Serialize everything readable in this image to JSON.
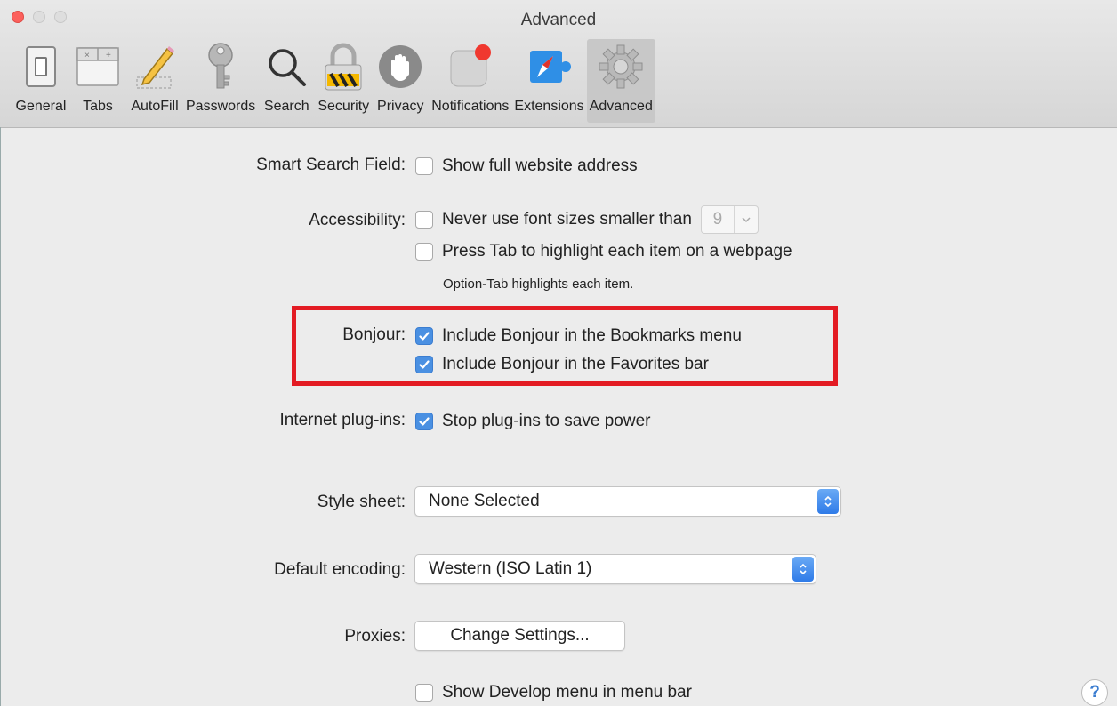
{
  "window": {
    "title": "Advanced"
  },
  "toolbar": {
    "tabs": [
      {
        "label": "General",
        "icon": "general-switch-icon"
      },
      {
        "label": "Tabs",
        "icon": "tabs-icon"
      },
      {
        "label": "AutoFill",
        "icon": "pencil-icon"
      },
      {
        "label": "Passwords",
        "icon": "key-icon"
      },
      {
        "label": "Search",
        "icon": "magnifier-icon"
      },
      {
        "label": "Security",
        "icon": "padlock-icon"
      },
      {
        "label": "Privacy",
        "icon": "hand-icon"
      },
      {
        "label": "Notifications",
        "icon": "notification-badge-icon"
      },
      {
        "label": "Extensions",
        "icon": "puzzle-compass-icon"
      },
      {
        "label": "Advanced",
        "icon": "gear-icon",
        "active": true
      }
    ]
  },
  "settings": {
    "smart_search": {
      "label": "Smart Search Field:",
      "option": "Show full website address",
      "checked": false
    },
    "accessibility": {
      "label": "Accessibility:",
      "font_option": "Never use font sizes smaller than",
      "font_option_checked": false,
      "font_size_value": "9",
      "tab_option": "Press Tab to highlight each item on a webpage",
      "tab_option_checked": false,
      "tab_note": "Option-Tab highlights each item."
    },
    "bonjour": {
      "label": "Bonjour:",
      "bookmarks_option": "Include Bonjour in the Bookmarks menu",
      "bookmarks_checked": true,
      "favorites_option": "Include Bonjour in the Favorites bar",
      "favorites_checked": true
    },
    "plugins": {
      "label": "Internet plug-ins:",
      "option": "Stop plug-ins to save power",
      "checked": true
    },
    "style_sheet": {
      "label": "Style sheet:",
      "value": "None Selected"
    },
    "encoding": {
      "label": "Default encoding:",
      "value": "Western (ISO Latin 1)"
    },
    "proxies": {
      "label": "Proxies:",
      "button": "Change Settings..."
    },
    "develop": {
      "option": "Show Develop menu in menu bar",
      "checked": false
    }
  },
  "help": {
    "label": "?"
  },
  "colors": {
    "accent": "#4a90e2",
    "highlight_box": "#e31b23",
    "close_light": "#fc605c"
  }
}
